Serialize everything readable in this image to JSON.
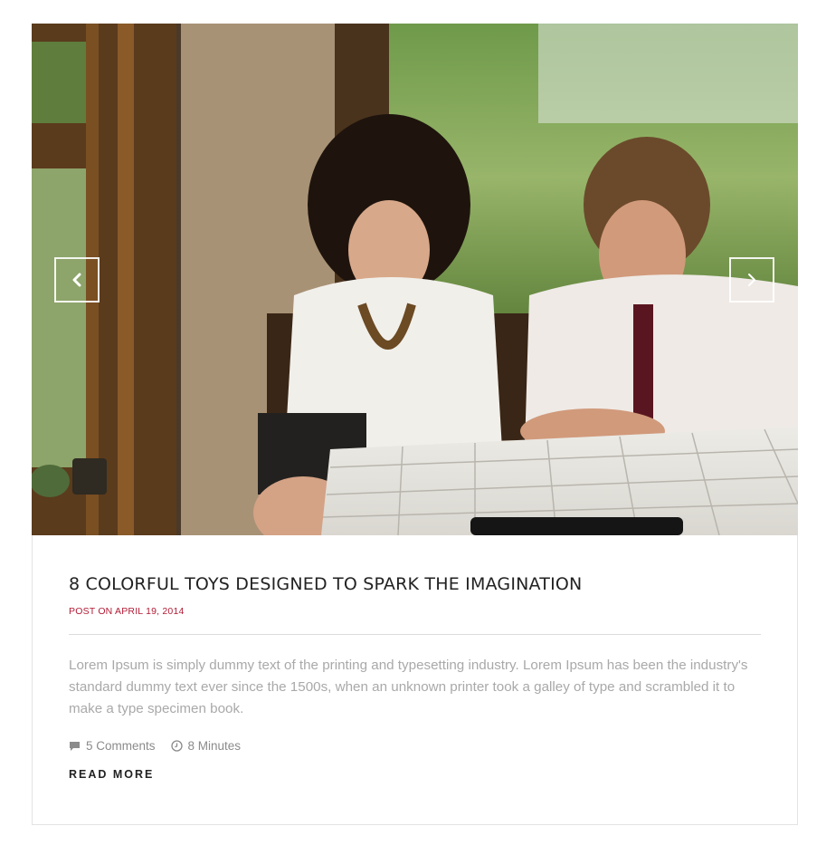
{
  "post": {
    "title": "8 COLORFUL TOYS DESIGNED TO SPARK THE IMAGINATION",
    "date": "POST ON APRIL 19, 2014",
    "excerpt": "Lorem Ipsum is simply dummy text of the printing and typesetting industry. Lorem Ipsum has been the industry's standard dummy text ever since the 1500s, when an unknown printer took a galley of type and scrambled it to make a type specimen book.",
    "comments": "5 Comments",
    "read_time": "8 Minutes",
    "read_more": "READ MORE"
  },
  "icons": {
    "prev": "chevron-left-icon",
    "next": "chevron-right-icon",
    "comments": "comment-icon",
    "time": "clock-icon"
  },
  "colors": {
    "date": "#b21b35",
    "title": "#222222",
    "excerpt": "#a9a9a9"
  }
}
